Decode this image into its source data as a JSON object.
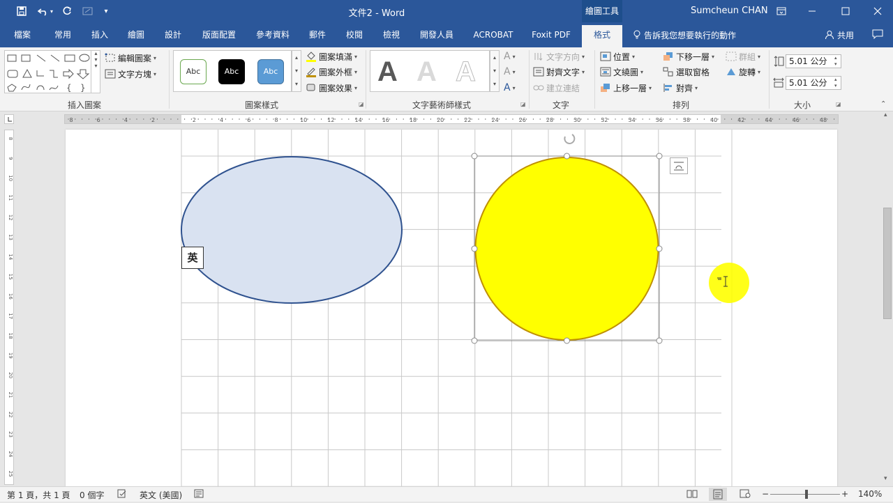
{
  "title_bar": {
    "document_title": "文件2 - Word",
    "contextual_tab_group": "繪圖工具",
    "user_name": "Sumcheun CHAN"
  },
  "tabs": [
    "檔案",
    "常用",
    "插入",
    "繪圖",
    "設計",
    "版面配置",
    "參考資料",
    "郵件",
    "校閱",
    "檢視",
    "開發人員",
    "ACROBAT",
    "Foxit PDF",
    "格式"
  ],
  "active_tab": "格式",
  "tell_me": "告訴我您想要執行的動作",
  "share": "共用",
  "ribbon": {
    "insert_shapes": {
      "edit_shape": "編輯圖案",
      "text_box": "文字方塊",
      "label": "插入圖案"
    },
    "shape_styles": {
      "abc1": "Abc",
      "abc2": "Abc",
      "abc3": "Abc",
      "fill": "圖案填滿",
      "outline": "圖案外框",
      "effects": "圖案效果",
      "label": "圖案樣式"
    },
    "wordart": {
      "label": "文字藝術師樣式",
      "letter": "A"
    },
    "text": {
      "direction": "文字方向",
      "align": "對齊文字",
      "link": "建立連結",
      "label": "文字"
    },
    "arrange": {
      "position": "位置",
      "wrap": "文繞圖",
      "forward": "上移一層",
      "backward": "下移一層",
      "selection_pane": "選取窗格",
      "align": "對齊",
      "group": "群組",
      "rotate": "旋轉",
      "label": "排列"
    },
    "size": {
      "height": "5.01 公分",
      "width": "5.01 公分",
      "label": "大小"
    }
  },
  "ruler_h_labels": [
    "8",
    "6",
    "4",
    "2",
    "2",
    "4",
    "6",
    "8",
    "10",
    "12",
    "14",
    "16",
    "18",
    "20",
    "22",
    "24",
    "26",
    "28",
    "30",
    "32",
    "34",
    "36",
    "38",
    "40",
    "42",
    "44",
    "46",
    "48"
  ],
  "ruler_v_labels": [
    "8",
    "9",
    "10",
    "11",
    "12",
    "13",
    "14",
    "15",
    "16",
    "17",
    "18",
    "19",
    "20",
    "21",
    "22",
    "23",
    "24",
    "25"
  ],
  "ime_indicator": "英",
  "status": {
    "page": "第 1 頁，共 1 頁",
    "words": "0 個字",
    "language": "英文 (美國)",
    "zoom": "140%"
  },
  "colors": {
    "brand": "#2b579a",
    "ellipse_fill": "#d9e2f1",
    "ellipse_stroke": "#2f528f",
    "circle_fill": "#ffff00",
    "circle_stroke": "#bf9000"
  }
}
